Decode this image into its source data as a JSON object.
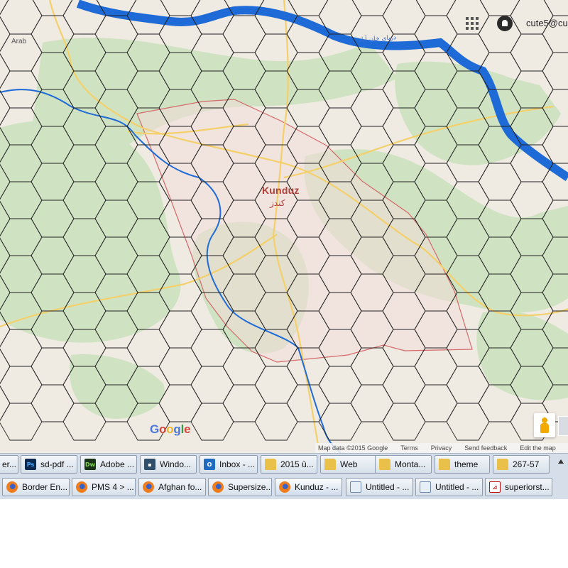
{
  "map": {
    "place_label_left": "Arab",
    "city_name": "Kunduz",
    "city_native": "کندز",
    "river_label": "دریای خان آباد",
    "colors": {
      "land": "#efeae2",
      "park": "#cfe3c2",
      "water": "#1e6bd8",
      "road": "#f4d06b",
      "city_fill": "#f3dcd8",
      "boundary": "#d46a6a",
      "hex_line": "#222222"
    }
  },
  "google_logo": {
    "g1": "G",
    "o1": "o",
    "o2": "o",
    "g2": "g",
    "l": "l",
    "e": "e"
  },
  "header": {
    "apps_icon": "apps-grid-icon",
    "notification_icon": "bell-icon",
    "user_email": "cute5@cu"
  },
  "attribution": {
    "map_data": "Map data ©2015 Google",
    "terms": "Terms",
    "privacy": "Privacy",
    "feedback": "Send feedback",
    "edit": "Edit the map"
  },
  "taskbar": {
    "row1": [
      {
        "label": "er...",
        "icon": "generic"
      },
      {
        "label": "sd-pdf ...",
        "icon": "photoshop"
      },
      {
        "label": "Adobe ...",
        "icon": "dreamweaver"
      },
      {
        "label": "Windo...",
        "icon": "window"
      },
      {
        "label": "Inbox - ...",
        "icon": "outlook"
      },
      {
        "label": "2015 û...",
        "icon": "folder"
      },
      {
        "label": "Web",
        "icon": "folder"
      },
      {
        "label": "Monta...",
        "icon": "folder"
      },
      {
        "label": "theme",
        "icon": "folder"
      },
      {
        "label": "267-57",
        "icon": "folder"
      }
    ],
    "row2": [
      {
        "label": "Border En...",
        "icon": "firefox"
      },
      {
        "label": "PMS 4 > ...",
        "icon": "firefox"
      },
      {
        "label": "Afghan fo...",
        "icon": "firefox"
      },
      {
        "label": "Supersize...",
        "icon": "firefox"
      },
      {
        "label": "Kunduz - ...",
        "icon": "firefox"
      },
      {
        "label": "Untitled - ...",
        "icon": "notepad"
      },
      {
        "label": "Untitled - ...",
        "icon": "notepad"
      },
      {
        "label": "superiorst...",
        "icon": "pdf"
      }
    ]
  }
}
